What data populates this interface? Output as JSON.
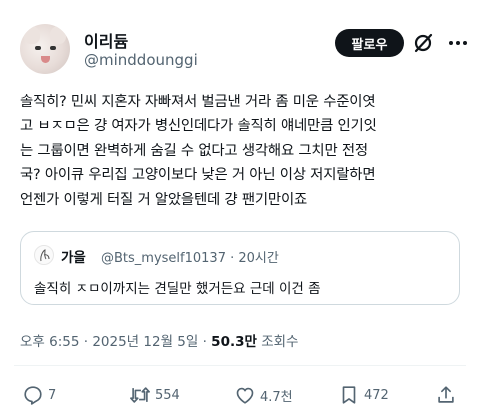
{
  "author": {
    "name": "이리듐",
    "handle": "@minddounggi",
    "follow_label": "팔로우"
  },
  "post": {
    "lines": [
      "솔직히? 민씨 지혼자 자빠져서 벌금낸 거라 좀 미운 수준이엿",
      "고 ㅂㅈㅁ은 걍 여자가 병신인데다가 솔직히 얘네만큼 인기잇",
      "는 그룹이면 완벽하게 숨길 수 없다고 생각해요 그치만 전정",
      "국? 아이큐 우리집 고양이보다 낮은 거 아닌 이상 저지랄하면",
      "언젠가 이렇게 터질 거 알았을텐데 걍 팬기만이죠"
    ]
  },
  "quote": {
    "name": "가을",
    "meta": "@Bts_myself10137 · 20시간",
    "text": "솔직히 ㅈㅁ이까지는 견딜만 했거든요 근데 이건 좀"
  },
  "meta": {
    "time_date": "오후 6:55 · 2025년 12월 5일 · ",
    "views_count": "50.3만",
    "views_label": " 조회수"
  },
  "actions": {
    "replies": "7",
    "reposts": "554",
    "likes": "4.7천",
    "bookmarks": "472"
  },
  "icons": [
    "grok-icon",
    "more-icon",
    "reply-icon",
    "repost-icon",
    "like-icon",
    "bookmark-icon",
    "share-icon"
  ]
}
